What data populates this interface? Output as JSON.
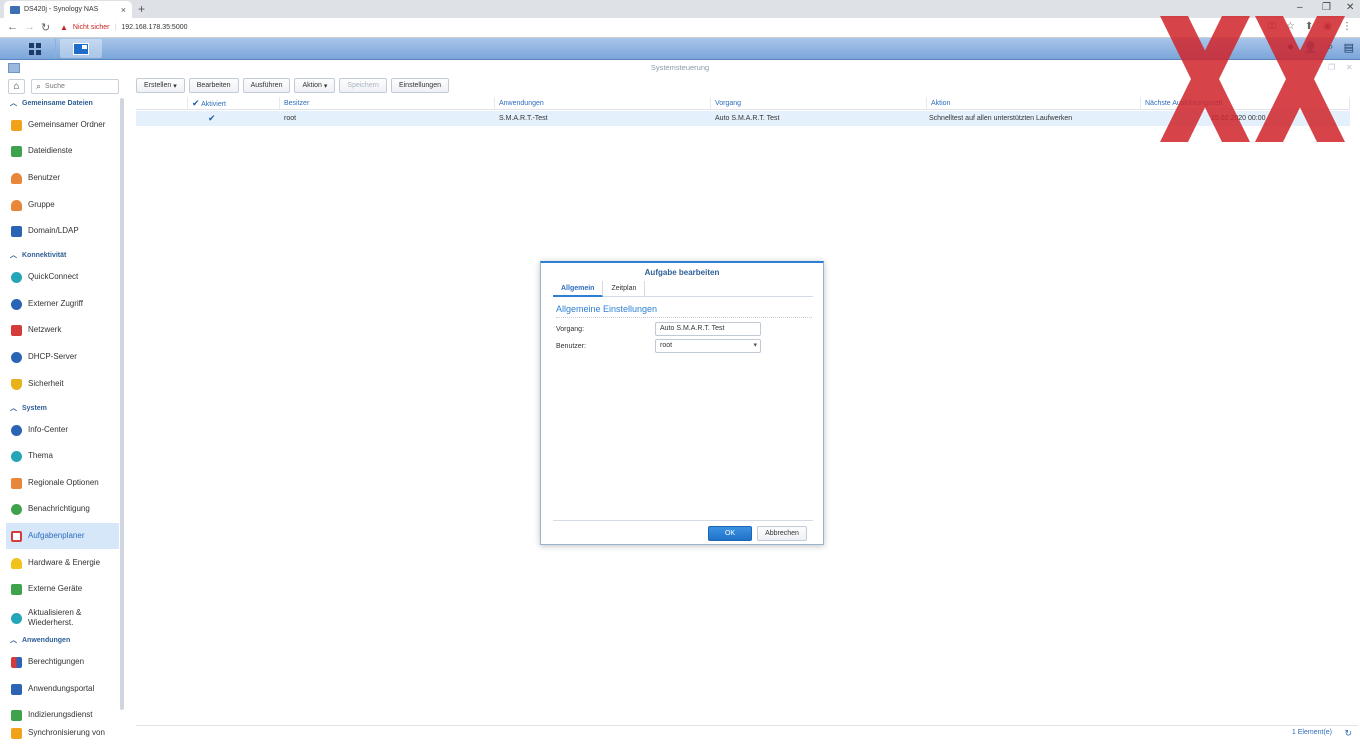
{
  "browser": {
    "tab_title": "DS420j - Synology NAS",
    "security_warning": "Nicht sicher",
    "url": "192.168.178.35:5000"
  },
  "window": {
    "title": "Systemsteuerung"
  },
  "sidebar": {
    "search_placeholder": "Suche",
    "sections": [
      {
        "label": "Gemeinsame Dateien"
      },
      {
        "label": "Konnektivität"
      },
      {
        "label": "System"
      },
      {
        "label": "Anwendungen"
      }
    ],
    "items": [
      {
        "label": "Gemeinsamer Ordner"
      },
      {
        "label": "Dateidienste"
      },
      {
        "label": "Benutzer"
      },
      {
        "label": "Gruppe"
      },
      {
        "label": "Domain/LDAP"
      },
      {
        "label": "QuickConnect"
      },
      {
        "label": "Externer Zugriff"
      },
      {
        "label": "Netzwerk"
      },
      {
        "label": "DHCP-Server"
      },
      {
        "label": "Sicherheit"
      },
      {
        "label": "Info-Center"
      },
      {
        "label": "Thema"
      },
      {
        "label": "Regionale Optionen"
      },
      {
        "label": "Benachrichtigung"
      },
      {
        "label": "Aufgabenplaner"
      },
      {
        "label": "Hardware & Energie"
      },
      {
        "label": "Externe Geräte"
      },
      {
        "label": "Aktualisieren &"
      },
      {
        "label": "Wiederherst."
      },
      {
        "label": "Berechtigungen"
      },
      {
        "label": "Anwendungsportal"
      },
      {
        "label": "Indizierungsdienst"
      },
      {
        "label": "Synchronisierung von"
      }
    ]
  },
  "toolbar": {
    "create": "Erstellen",
    "edit": "Bearbeiten",
    "run": "Ausführen",
    "action": "Aktion",
    "save": "Speichern",
    "settings": "Einstellungen"
  },
  "grid": {
    "headers": [
      "Aktiviert",
      "Besitzer",
      "Anwendungen",
      "Vorgang",
      "Aktion",
      "Nächste Ausführungszeit"
    ],
    "rows": [
      {
        "owner": "root",
        "application": "S.M.A.R.T.-Test",
        "task": "Auto S.M.A.R.T. Test",
        "action": "Schnelltest auf allen unterstützten Laufwerken",
        "next_run": "15.02.2020 00:00"
      }
    ],
    "footer_count": "1 Element(e)"
  },
  "dialog": {
    "title": "Aufgabe bearbeiten",
    "tabs": [
      "Allgemein",
      "Zeitplan"
    ],
    "section_title": "Allgemeine Einstellungen",
    "task_label": "Vorgang:",
    "task_value": "Auto S.M.A.R.T. Test",
    "user_label": "Benutzer:",
    "user_value": "root",
    "ok": "OK",
    "cancel": "Abbrechen"
  },
  "colors": {
    "accent": "#2d7fd3",
    "selection": "#e4f0fb",
    "watermark": "#d0242b"
  }
}
